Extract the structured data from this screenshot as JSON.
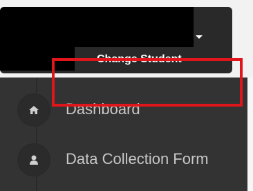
{
  "header": {
    "change_student_label": "Change Student"
  },
  "sidebar": {
    "items": [
      {
        "label": "Dashboard",
        "icon": "home-icon"
      },
      {
        "label": "Data Collection Form",
        "icon": "user-icon",
        "highlighted": true
      }
    ]
  },
  "colors": {
    "sidebar_bg": "#333333",
    "highlight": "#e0161a",
    "text": "#c8c8c8"
  }
}
